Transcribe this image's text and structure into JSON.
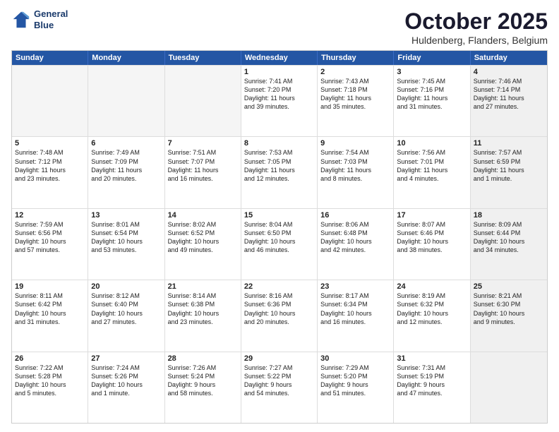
{
  "header": {
    "logo_line1": "General",
    "logo_line2": "Blue",
    "month_title": "October 2025",
    "location": "Huldenberg, Flanders, Belgium"
  },
  "calendar": {
    "days": [
      "Sunday",
      "Monday",
      "Tuesday",
      "Wednesday",
      "Thursday",
      "Friday",
      "Saturday"
    ],
    "rows": [
      [
        {
          "day": "",
          "text": "",
          "empty": true
        },
        {
          "day": "",
          "text": "",
          "empty": true
        },
        {
          "day": "",
          "text": "",
          "empty": true
        },
        {
          "day": "1",
          "text": "Sunrise: 7:41 AM\nSunset: 7:20 PM\nDaylight: 11 hours\nand 39 minutes."
        },
        {
          "day": "2",
          "text": "Sunrise: 7:43 AM\nSunset: 7:18 PM\nDaylight: 11 hours\nand 35 minutes."
        },
        {
          "day": "3",
          "text": "Sunrise: 7:45 AM\nSunset: 7:16 PM\nDaylight: 11 hours\nand 31 minutes."
        },
        {
          "day": "4",
          "text": "Sunrise: 7:46 AM\nSunset: 7:14 PM\nDaylight: 11 hours\nand 27 minutes.",
          "shaded": true
        }
      ],
      [
        {
          "day": "5",
          "text": "Sunrise: 7:48 AM\nSunset: 7:12 PM\nDaylight: 11 hours\nand 23 minutes."
        },
        {
          "day": "6",
          "text": "Sunrise: 7:49 AM\nSunset: 7:09 PM\nDaylight: 11 hours\nand 20 minutes."
        },
        {
          "day": "7",
          "text": "Sunrise: 7:51 AM\nSunset: 7:07 PM\nDaylight: 11 hours\nand 16 minutes."
        },
        {
          "day": "8",
          "text": "Sunrise: 7:53 AM\nSunset: 7:05 PM\nDaylight: 11 hours\nand 12 minutes."
        },
        {
          "day": "9",
          "text": "Sunrise: 7:54 AM\nSunset: 7:03 PM\nDaylight: 11 hours\nand 8 minutes."
        },
        {
          "day": "10",
          "text": "Sunrise: 7:56 AM\nSunset: 7:01 PM\nDaylight: 11 hours\nand 4 minutes."
        },
        {
          "day": "11",
          "text": "Sunrise: 7:57 AM\nSunset: 6:59 PM\nDaylight: 11 hours\nand 1 minute.",
          "shaded": true
        }
      ],
      [
        {
          "day": "12",
          "text": "Sunrise: 7:59 AM\nSunset: 6:56 PM\nDaylight: 10 hours\nand 57 minutes."
        },
        {
          "day": "13",
          "text": "Sunrise: 8:01 AM\nSunset: 6:54 PM\nDaylight: 10 hours\nand 53 minutes."
        },
        {
          "day": "14",
          "text": "Sunrise: 8:02 AM\nSunset: 6:52 PM\nDaylight: 10 hours\nand 49 minutes."
        },
        {
          "day": "15",
          "text": "Sunrise: 8:04 AM\nSunset: 6:50 PM\nDaylight: 10 hours\nand 46 minutes."
        },
        {
          "day": "16",
          "text": "Sunrise: 8:06 AM\nSunset: 6:48 PM\nDaylight: 10 hours\nand 42 minutes."
        },
        {
          "day": "17",
          "text": "Sunrise: 8:07 AM\nSunset: 6:46 PM\nDaylight: 10 hours\nand 38 minutes."
        },
        {
          "day": "18",
          "text": "Sunrise: 8:09 AM\nSunset: 6:44 PM\nDaylight: 10 hours\nand 34 minutes.",
          "shaded": true
        }
      ],
      [
        {
          "day": "19",
          "text": "Sunrise: 8:11 AM\nSunset: 6:42 PM\nDaylight: 10 hours\nand 31 minutes."
        },
        {
          "day": "20",
          "text": "Sunrise: 8:12 AM\nSunset: 6:40 PM\nDaylight: 10 hours\nand 27 minutes."
        },
        {
          "day": "21",
          "text": "Sunrise: 8:14 AM\nSunset: 6:38 PM\nDaylight: 10 hours\nand 23 minutes."
        },
        {
          "day": "22",
          "text": "Sunrise: 8:16 AM\nSunset: 6:36 PM\nDaylight: 10 hours\nand 20 minutes."
        },
        {
          "day": "23",
          "text": "Sunrise: 8:17 AM\nSunset: 6:34 PM\nDaylight: 10 hours\nand 16 minutes."
        },
        {
          "day": "24",
          "text": "Sunrise: 8:19 AM\nSunset: 6:32 PM\nDaylight: 10 hours\nand 12 minutes."
        },
        {
          "day": "25",
          "text": "Sunrise: 8:21 AM\nSunset: 6:30 PM\nDaylight: 10 hours\nand 9 minutes.",
          "shaded": true
        }
      ],
      [
        {
          "day": "26",
          "text": "Sunrise: 7:22 AM\nSunset: 5:28 PM\nDaylight: 10 hours\nand 5 minutes."
        },
        {
          "day": "27",
          "text": "Sunrise: 7:24 AM\nSunset: 5:26 PM\nDaylight: 10 hours\nand 1 minute."
        },
        {
          "day": "28",
          "text": "Sunrise: 7:26 AM\nSunset: 5:24 PM\nDaylight: 9 hours\nand 58 minutes."
        },
        {
          "day": "29",
          "text": "Sunrise: 7:27 AM\nSunset: 5:22 PM\nDaylight: 9 hours\nand 54 minutes."
        },
        {
          "day": "30",
          "text": "Sunrise: 7:29 AM\nSunset: 5:20 PM\nDaylight: 9 hours\nand 51 minutes."
        },
        {
          "day": "31",
          "text": "Sunrise: 7:31 AM\nSunset: 5:19 PM\nDaylight: 9 hours\nand 47 minutes."
        },
        {
          "day": "",
          "text": "",
          "empty": true,
          "shaded": true
        }
      ]
    ]
  }
}
